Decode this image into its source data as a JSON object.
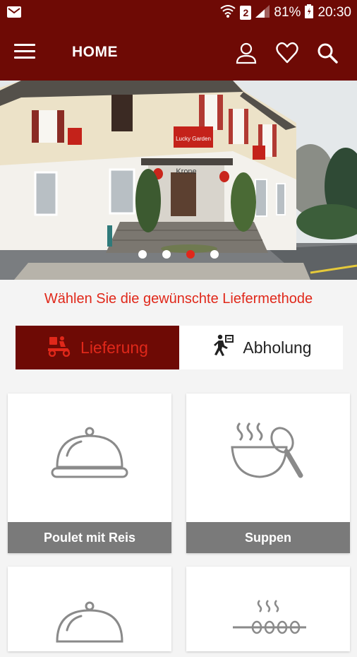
{
  "status_bar": {
    "sim_badge": "2",
    "battery_percent": "81%",
    "time": "20:30",
    "icons": [
      "gmail-icon",
      "wifi-icon",
      "signal-icon",
      "battery-icon"
    ]
  },
  "app_bar": {
    "title": "HOME",
    "icons": [
      "menu-icon",
      "user-icon",
      "heart-icon",
      "search-icon"
    ]
  },
  "hero": {
    "slide_count": 4,
    "active_slide": 3,
    "sign_text": "Lucky Garden",
    "facade_text": "Krone"
  },
  "delivery": {
    "prompt": "Wählen Sie die gewünschte Liefermethode",
    "options": [
      {
        "label": "Lieferung",
        "icon": "scooter-icon",
        "selected": true
      },
      {
        "label": "Abholung",
        "icon": "running-person-icon",
        "selected": false
      }
    ]
  },
  "categories": [
    {
      "label": "Poulet mit Reis",
      "icon": "cloche-icon"
    },
    {
      "label": "Suppen",
      "icon": "soup-bowl-icon"
    },
    {
      "label": "",
      "icon": "cloche-icon"
    },
    {
      "label": "",
      "icon": "grill-skewer-icon"
    }
  ],
  "colors": {
    "brand": "#6e0a05",
    "accent": "#e0281a",
    "card_label_bg": "#7a7a7a"
  }
}
